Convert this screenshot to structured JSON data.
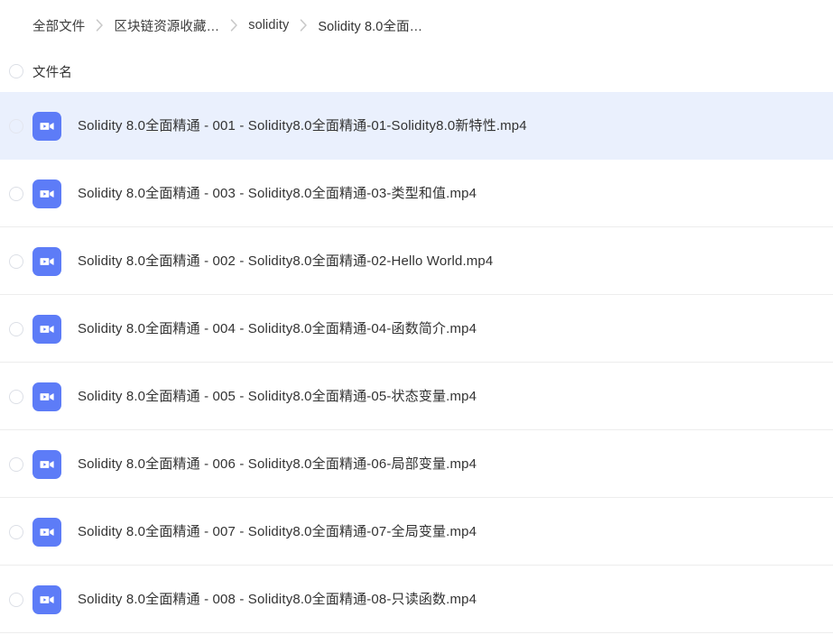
{
  "breadcrumb": {
    "separator_icon": "chevron-right-icon",
    "items": [
      {
        "label": "全部文件"
      },
      {
        "label": "区块链资源收藏…"
      },
      {
        "label": "solidity"
      },
      {
        "label": "Solidity 8.0全面…"
      }
    ]
  },
  "list_header": {
    "select_all_icon": "circle-checkbox-icon",
    "name_column": "文件名"
  },
  "colors": {
    "accent": "#5d7cf7",
    "selected_row": "#eaf0fd",
    "row_separator": "#ededed",
    "text": "#333333",
    "checkbox_border": "#dcdfe6"
  },
  "files": [
    {
      "name": "Solidity 8.0全面精通 - 001 - Solidity8.0全面精通-01-Solidity8.0新特性.mp4",
      "icon": "video-file-icon",
      "selected": true
    },
    {
      "name": "Solidity 8.0全面精通 - 003 - Solidity8.0全面精通-03-类型和值.mp4",
      "icon": "video-file-icon",
      "selected": false
    },
    {
      "name": "Solidity 8.0全面精通 - 002 - Solidity8.0全面精通-02-Hello World.mp4",
      "icon": "video-file-icon",
      "selected": false
    },
    {
      "name": "Solidity 8.0全面精通 - 004 - Solidity8.0全面精通-04-函数简介.mp4",
      "icon": "video-file-icon",
      "selected": false
    },
    {
      "name": "Solidity 8.0全面精通 - 005 - Solidity8.0全面精通-05-状态变量.mp4",
      "icon": "video-file-icon",
      "selected": false
    },
    {
      "name": "Solidity 8.0全面精通 - 006 - Solidity8.0全面精通-06-局部变量.mp4",
      "icon": "video-file-icon",
      "selected": false
    },
    {
      "name": "Solidity 8.0全面精通 - 007 - Solidity8.0全面精通-07-全局变量.mp4",
      "icon": "video-file-icon",
      "selected": false
    },
    {
      "name": "Solidity 8.0全面精通 - 008 - Solidity8.0全面精通-08-只读函数.mp4",
      "icon": "video-file-icon",
      "selected": false
    }
  ]
}
